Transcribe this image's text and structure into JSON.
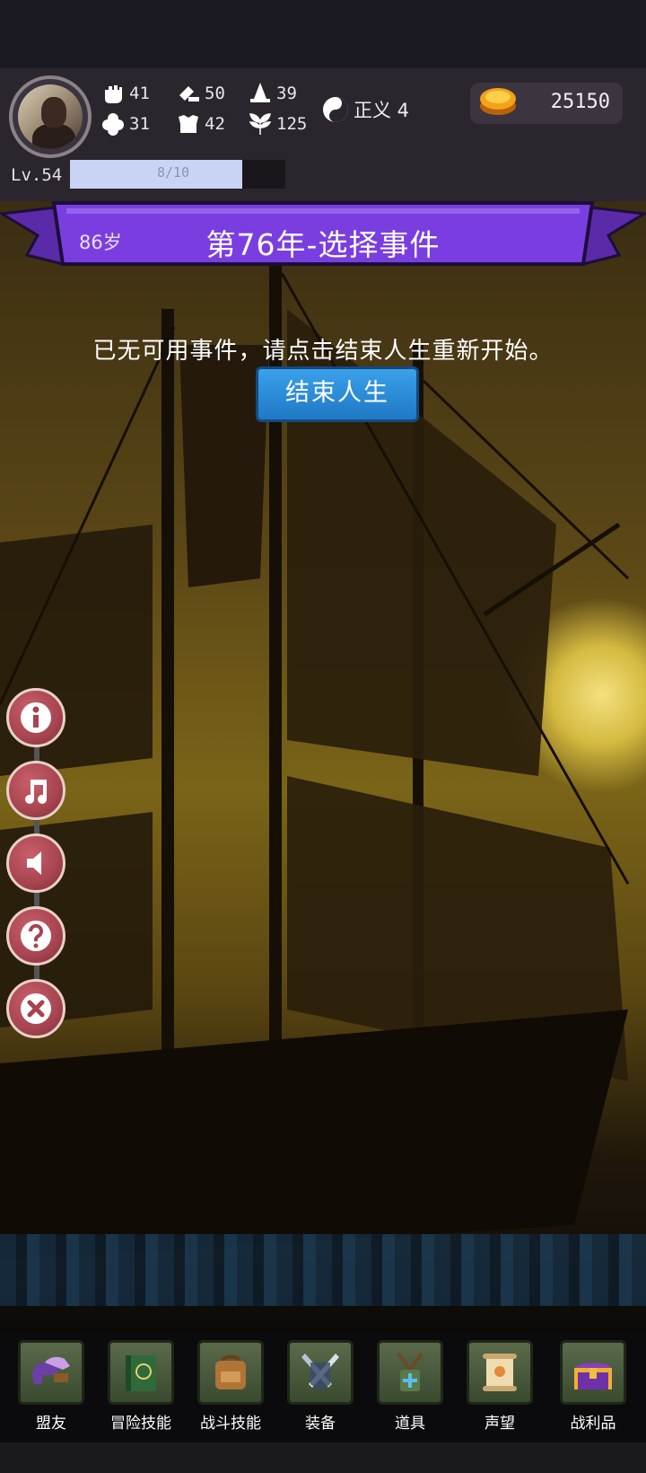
{
  "header": {
    "stats": [
      {
        "icon": "fist-icon",
        "value": "41"
      },
      {
        "icon": "clover-icon",
        "value": "31"
      },
      {
        "icon": "hammer-icon",
        "value": "50"
      },
      {
        "icon": "armor-icon",
        "value": "42"
      },
      {
        "icon": "wizard-hat-icon",
        "value": "39"
      },
      {
        "icon": "leaf-icon",
        "value": "125"
      }
    ],
    "justice_label": "正义 4",
    "gold": "25150",
    "level": "Lv.54",
    "xp_text": "8/10",
    "xp_fraction": 0.8
  },
  "banner": {
    "age": "86岁",
    "title": "第76年-选择事件"
  },
  "notice": "已无可用事件，请点击结束人生重新开始。",
  "end_button": "结束人生",
  "side_buttons": [
    "info-icon",
    "music-icon",
    "sound-icon",
    "help-icon",
    "close-icon"
  ],
  "nav": [
    {
      "label": "盟友",
      "icon": "gloves-icon"
    },
    {
      "label": "冒险技能",
      "icon": "spellbook-icon"
    },
    {
      "label": "战斗技能",
      "icon": "backpack-icon"
    },
    {
      "label": "装备",
      "icon": "crossed-swords-icon"
    },
    {
      "label": "道具",
      "icon": "amulet-icon"
    },
    {
      "label": "声望",
      "icon": "scroll-icon"
    },
    {
      "label": "战利品",
      "icon": "treasure-chest-icon"
    }
  ],
  "colors": {
    "banner": "#7a3ee0",
    "button": "#2a8ad6",
    "side_button": "#a64450"
  }
}
